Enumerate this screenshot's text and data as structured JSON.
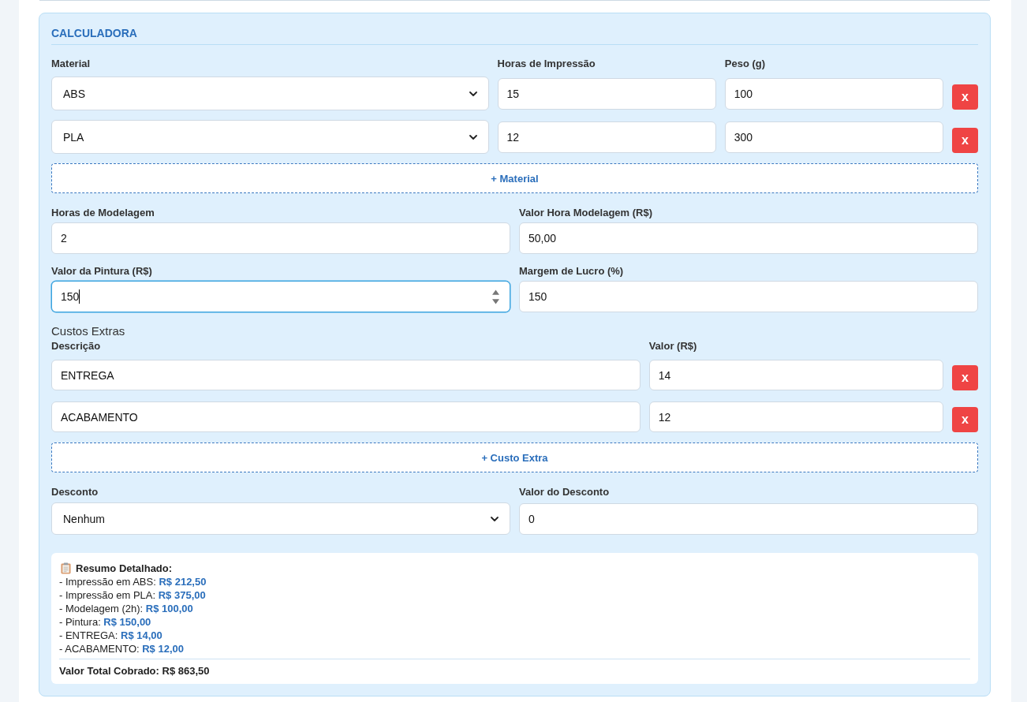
{
  "calculator": {
    "title": "CALCULADORA",
    "materials": {
      "columns": [
        "Material",
        "Horas de Impressão",
        "Peso (g)"
      ],
      "rows": [
        {
          "material": "ABS",
          "print_hours": "15",
          "weight": "100",
          "remove": "x"
        },
        {
          "material": "PLA",
          "print_hours": "12",
          "weight": "300",
          "remove": "x"
        }
      ],
      "add_button": "+ Material"
    },
    "fields": [
      {
        "kind": "input",
        "label": "Horas de Modelagem",
        "value": "2",
        "focused": false
      },
      {
        "kind": "input",
        "label": "Valor Hora Modelagem (R$)",
        "value": "50,00",
        "focused": false
      },
      {
        "kind": "input",
        "label": "Valor da Pintura (R$)",
        "value": "150",
        "focused": true
      },
      {
        "kind": "input",
        "label": "Margem de Lucro (%)",
        "value": "150",
        "focused": false
      }
    ],
    "extras": {
      "heading": "Custos Extras",
      "columns": [
        "Descrição",
        "Valor (R$)"
      ],
      "rows": [
        {
          "description": "ENTREGA",
          "value": "14",
          "remove": "x"
        },
        {
          "description": "ACABAMENTO",
          "value": "12",
          "remove": "x"
        }
      ],
      "add_button": "+ Custo Extra"
    },
    "discount_fields": [
      {
        "kind": "select",
        "label": "Desconto",
        "value": "Nenhum",
        "focused": false
      },
      {
        "kind": "input",
        "label": "Valor do Desconto",
        "value": "0",
        "focused": false
      }
    ],
    "summary": {
      "title": "Resumo Detalhado:",
      "lines": [
        "- Impressão em ABS: **R$ 212,50**",
        "- Impressão em PLA: **R$ 375,00**",
        "- Modelagem (2h): **R$ 100,00**",
        "- Pintura: **R$ 150,00**",
        "- ENTREGA: **R$ 14,00**",
        "- ACABAMENTO: **R$ 12,00**"
      ],
      "total": "Valor Total Cobrado: R$ 863,50"
    }
  }
}
